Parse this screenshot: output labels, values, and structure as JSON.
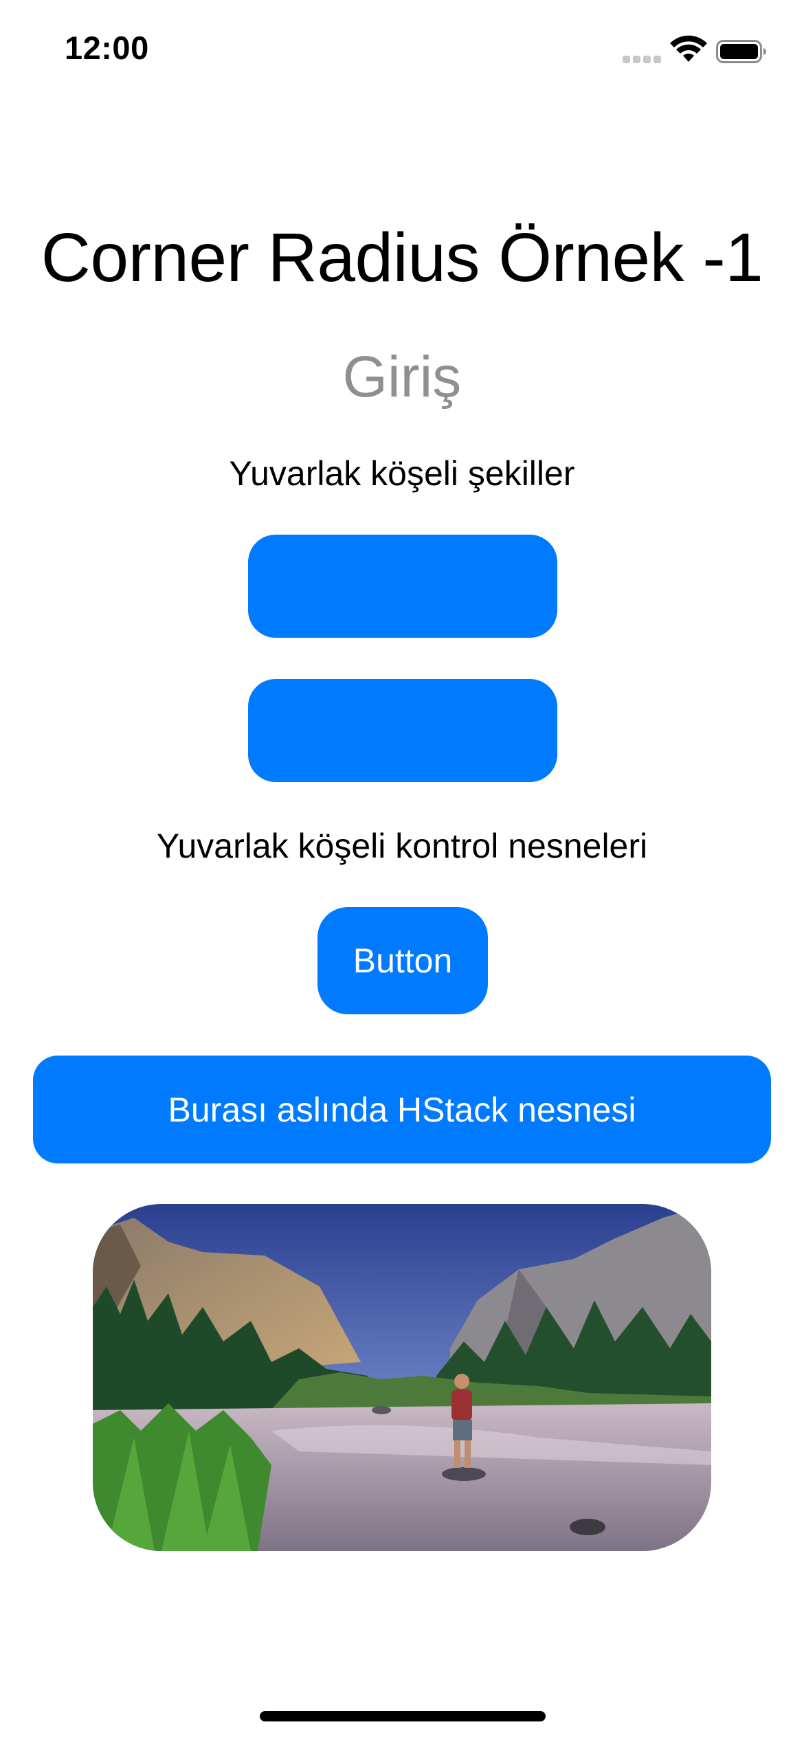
{
  "status_bar": {
    "time": "12:00",
    "icons": [
      "cellular-signal-icon",
      "wifi-icon",
      "battery-icon"
    ]
  },
  "page": {
    "title": "Corner Radius Örnek -1",
    "subtitle": "Giriş",
    "shapes_label": "Yuvarlak köşeli şekiller",
    "controls_label": "Yuvarlak köşeli kontrol nesneleri",
    "button_label": "Button",
    "hstack_label": "Burası aslında HStack nesnesi"
  },
  "colors": {
    "accent": "#007aff",
    "subtitle_gray": "#8e8e93"
  }
}
